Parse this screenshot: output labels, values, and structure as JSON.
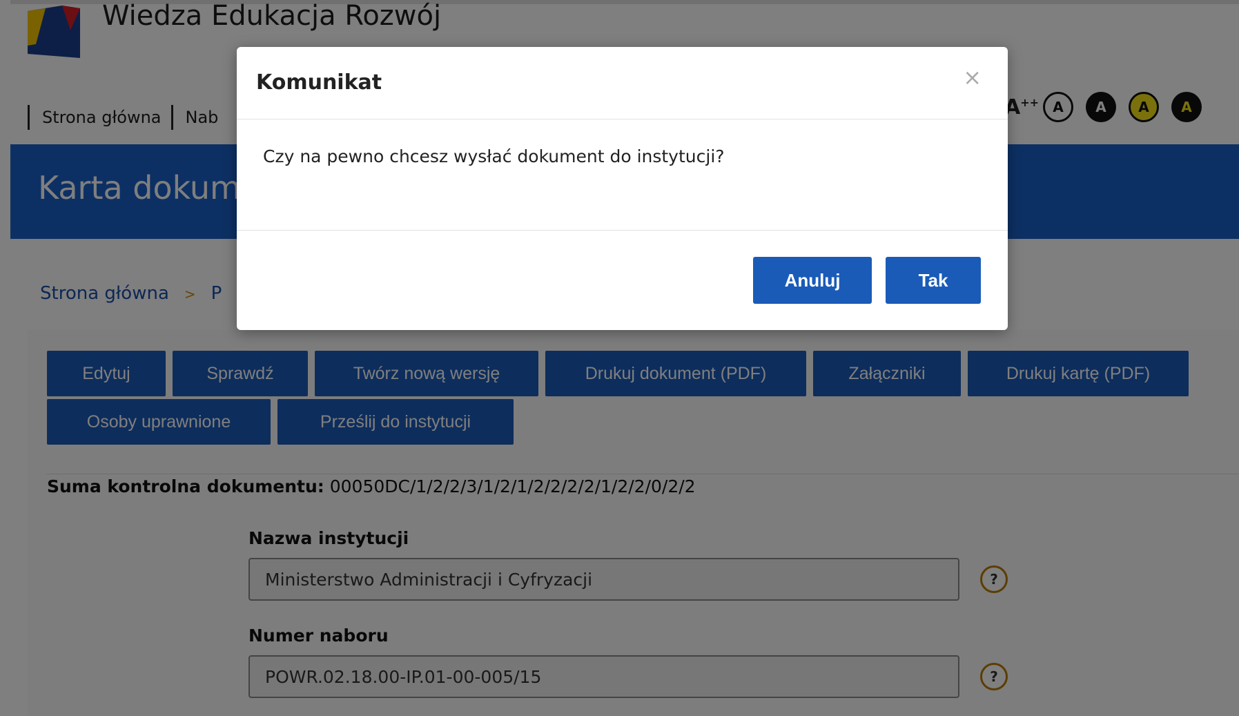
{
  "header": {
    "site_title": "Wiedza Edukacja Rozwój",
    "nav": [
      "Strona główna",
      "Nab"
    ],
    "font_size_label": "A",
    "font_size_suffix": "++",
    "contrast_options": [
      "A",
      "A",
      "A",
      "A"
    ]
  },
  "banner": {
    "title": "Karta dokume"
  },
  "breadcrumb": {
    "home": "Strona główna",
    "separator": ">",
    "next": "P"
  },
  "actions": {
    "row1": [
      "Edytuj",
      "Sprawdź",
      "Twórz nową wersję",
      "Drukuj dokument (PDF)",
      "Załączniki",
      "Drukuj kartę (PDF)"
    ],
    "row2": [
      "Osoby uprawnione",
      "Prześlij do instytucji"
    ]
  },
  "checksum": {
    "label": "Suma kontrolna dokumentu:",
    "value": " 00050DC/1/2/2/3/1/2/1/2/2/2/2/1/2/2/0/2/2"
  },
  "fields": [
    {
      "label": "Nazwa instytucji",
      "value": "Ministerstwo Administracji i Cyfryzacji",
      "help": "?"
    },
    {
      "label": "Numer naboru",
      "value": "POWR.02.18.00-IP.01-00-005/15",
      "help": "?"
    }
  ],
  "modal": {
    "title": "Komunikat",
    "close": "×",
    "message": "Czy na pewno chcesz wysłać dokument do instytucji?",
    "cancel_label": "Anuluj",
    "confirm_label": "Tak"
  },
  "colors": {
    "primary_blue": "#1a5bb8",
    "banner_blue": "#1a61c8",
    "help_ring": "#b87a00",
    "contrast_yellow": "#f5e31a"
  }
}
